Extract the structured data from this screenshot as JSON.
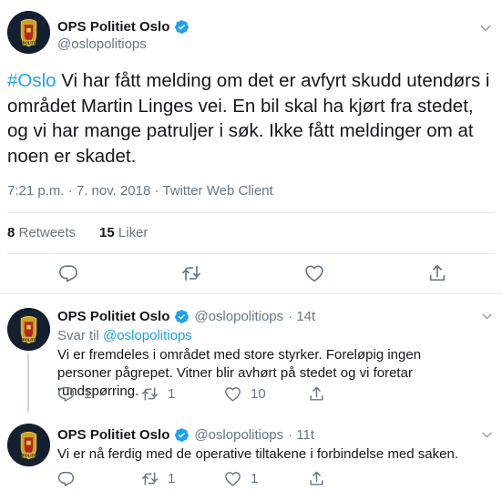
{
  "main_tweet": {
    "display_name": "OPS Politiet Oslo",
    "handle": "@oslopolitiops",
    "hashtag": "#Oslo",
    "text": " Vi har fått melding om det er avfyrt skudd utendørs i området Martin Linges vei. En bil skal ha kjørt fra stedet, og vi har mange patruljer i søk. Ikke fått meldinger om at noen er skadet.",
    "timestamp": "7:21 p.m. · 7. nov. 2018 · Twitter Web Client",
    "retweets_count": "8",
    "retweets_label": "Retweets",
    "likes_count": "15",
    "likes_label": "Liker"
  },
  "replies": [
    {
      "display_name": "OPS Politiet Oslo",
      "handle": "@oslopolitiops",
      "time": "· 14t",
      "replying_prefix": "Svar til",
      "replying_to": "@oslopolitiops",
      "text": "Vi er fremdeles i området med store styrker. Foreløpig ingen personer pågrepet. Vitner blir avhørt på stedet og vi foretar rundspørring.",
      "reply_count": "1",
      "retweet_count": "1",
      "like_count": "10"
    },
    {
      "display_name": "OPS Politiet Oslo",
      "handle": "@oslopolitiops",
      "time": "· 11t",
      "text": "Vi er nå ferdig med de operative tiltakene i forbindelse med saken.",
      "reply_count": "",
      "retweet_count": "1",
      "like_count": "1"
    }
  ],
  "icons": {
    "verified": "verified-badge-icon",
    "menu": "chevron-down-icon",
    "reply": "reply-icon",
    "retweet": "retweet-icon",
    "like": "heart-icon",
    "share": "share-icon",
    "avatar_logo": "police-badge-logo"
  },
  "colors": {
    "accent": "#1da1f2",
    "text": "#14171a",
    "secondary": "#657786",
    "border": "#e1e8ed"
  }
}
